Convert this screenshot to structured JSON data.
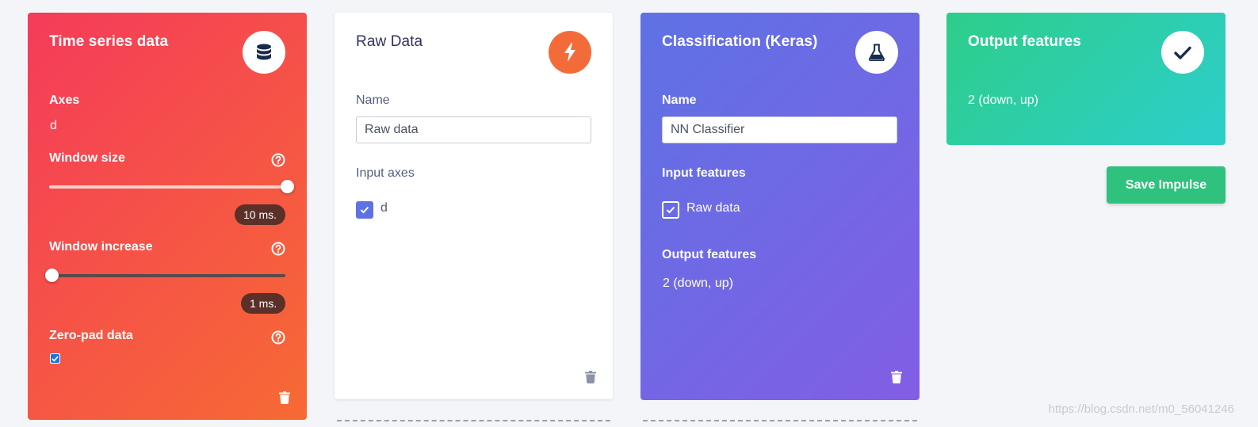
{
  "time_series_card": {
    "title": "Time series data",
    "icon": "database-icon",
    "axes_label": "Axes",
    "axes_value": "d",
    "window_size_label": "Window size",
    "window_size_value": "10 ms.",
    "window_size_slider_fraction": 1.0,
    "window_increase_label": "Window increase",
    "window_increase_value": "1 ms.",
    "window_increase_slider_fraction": 0.0,
    "zero_pad_label": "Zero-pad data",
    "zero_pad_checked": true,
    "gradient_start": "#f53b5a",
    "gradient_end": "#f66a34"
  },
  "raw_data_card": {
    "title": "Raw Data",
    "icon": "lightning-bolt-icon",
    "icon_bg": "#f46b3a",
    "name_label": "Name",
    "name_value": "Raw data",
    "input_axes_label": "Input axes",
    "input_axis_option": "d",
    "input_axis_checked": true
  },
  "classification_card": {
    "title": "Classification (Keras)",
    "icon": "flask-icon",
    "name_label": "Name",
    "name_value": "NN Classifier",
    "input_features_label": "Input features",
    "input_feature_option": "Raw data",
    "input_feature_checked": true,
    "output_features_label": "Output features",
    "output_features_value": "2 (down, up)",
    "gradient_start": "#5e72e4",
    "gradient_end": "#825ee4"
  },
  "output_card": {
    "title": "Output features",
    "icon": "checkmark-icon",
    "value": "2 (down, up)",
    "gradient_start": "#2dce89",
    "gradient_end": "#2dcecc"
  },
  "save_button": {
    "label": "Save Impulse",
    "color": "#2ec27e"
  },
  "watermark": "https://blog.csdn.net/m0_56041246"
}
